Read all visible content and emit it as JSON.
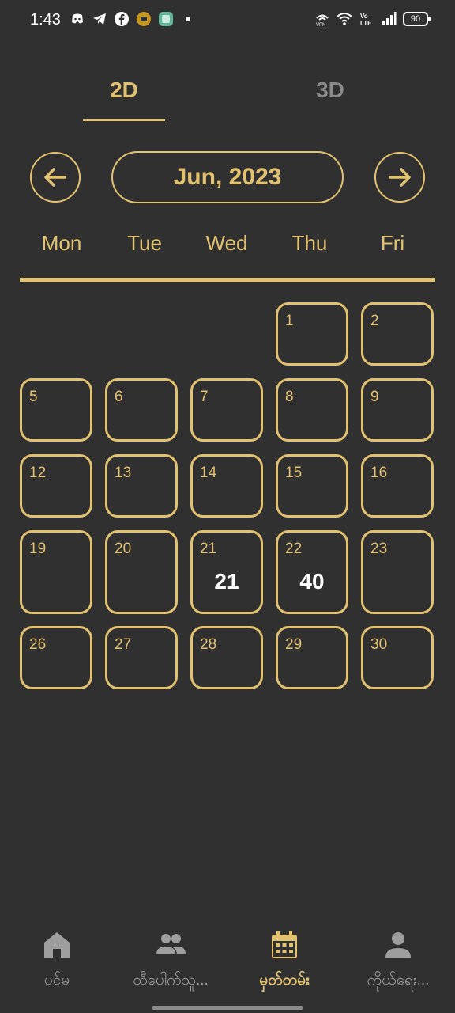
{
  "status_bar": {
    "time": "1:43",
    "battery": "90",
    "left_icons": [
      "discord-icon",
      "telegram-icon",
      "facebook-icon",
      "app-icon",
      "app-icon-2",
      "dot-icon"
    ],
    "right_icons": [
      "vpn-icon",
      "wifi-icon",
      "volte-icon",
      "signal-icon",
      "battery-icon"
    ]
  },
  "tabs": [
    {
      "label": "2D",
      "active": true
    },
    {
      "label": "3D",
      "active": false
    }
  ],
  "month_nav": {
    "title": "Jun, 2023",
    "prev_icon": "arrow-left-icon",
    "next_icon": "arrow-right-icon"
  },
  "weekdays": [
    "Mon",
    "Tue",
    "Wed",
    "Thu",
    "Fri"
  ],
  "calendar": {
    "weeks": [
      [
        null,
        null,
        null,
        {
          "day": "1",
          "result": ""
        },
        {
          "day": "2",
          "result": ""
        }
      ],
      [
        {
          "day": "5",
          "result": ""
        },
        {
          "day": "6",
          "result": ""
        },
        {
          "day": "7",
          "result": ""
        },
        {
          "day": "8",
          "result": ""
        },
        {
          "day": "9",
          "result": ""
        }
      ],
      [
        {
          "day": "12",
          "result": ""
        },
        {
          "day": "13",
          "result": ""
        },
        {
          "day": "14",
          "result": ""
        },
        {
          "day": "15",
          "result": ""
        },
        {
          "day": "16",
          "result": ""
        }
      ],
      [
        {
          "day": "19",
          "result": ""
        },
        {
          "day": "20",
          "result": ""
        },
        {
          "day": "21",
          "result": "21"
        },
        {
          "day": "22",
          "result": "40"
        },
        {
          "day": "23",
          "result": ""
        }
      ],
      [
        {
          "day": "26",
          "result": ""
        },
        {
          "day": "27",
          "result": ""
        },
        {
          "day": "28",
          "result": ""
        },
        {
          "day": "29",
          "result": ""
        },
        {
          "day": "30",
          "result": ""
        }
      ]
    ]
  },
  "bottom_nav": [
    {
      "label": "ပင်မ",
      "icon": "home-icon",
      "active": false
    },
    {
      "label": "ထီပေါက်သူ...",
      "icon": "people-icon",
      "active": false
    },
    {
      "label": "မှတ်တမ်း",
      "icon": "calendar-icon",
      "active": true
    },
    {
      "label": "ကိုယ်ရေး...",
      "icon": "person-icon",
      "active": false
    }
  ],
  "colors": {
    "background": "#303030",
    "accent": "#e2c270",
    "inactive": "#9e9e9e",
    "result_text": "#ffffff"
  }
}
